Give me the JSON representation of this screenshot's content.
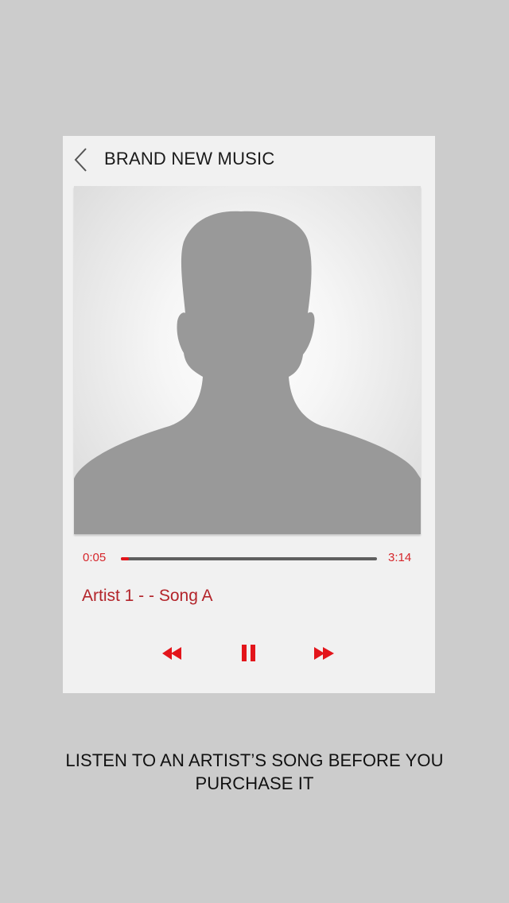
{
  "app": {
    "title": "BRAND NEW MUSIC",
    "back_icon": "chevron-left-icon"
  },
  "artwork": {
    "icon": "person-silhouette-icon"
  },
  "player": {
    "elapsed": "0:05",
    "duration": "3:14",
    "progress_percent": 3,
    "track_title": "Artist 1 - - Song A",
    "controls": [
      {
        "name": "rewind",
        "icon": "rewind-icon"
      },
      {
        "name": "pause",
        "icon": "pause-icon"
      },
      {
        "name": "fast-forward",
        "icon": "fast-forward-icon"
      }
    ]
  },
  "caption": {
    "line1": "LISTEN TO AN ARTIST’S SONG BEFORE YOU",
    "line2": "PURCHASE IT"
  },
  "colors": {
    "accent": "#e3151b",
    "track_text": "#b3242a",
    "background": "#cccccc",
    "card": "#f1f1f1",
    "silhouette": "#999999"
  }
}
